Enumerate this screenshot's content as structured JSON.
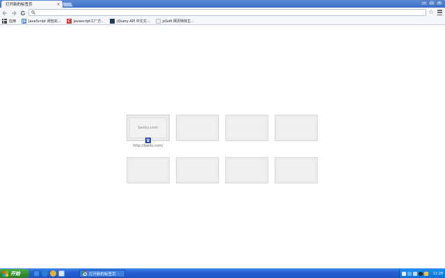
{
  "browser": {
    "tab": {
      "title": "打开新的标签页",
      "close": "×"
    },
    "window_controls": {
      "minimize": "–",
      "maximize": "□",
      "close": "×"
    },
    "omnibox": {
      "value": "",
      "placeholder": ""
    },
    "icons": {
      "back": "back-arrow-icon",
      "forward": "forward-arrow-icon",
      "reload": "reload-icon",
      "star": "star-icon",
      "menu": "menu-icon"
    }
  },
  "bookmarks": {
    "apps_label": "应用",
    "items": [
      {
        "label": "JavaScript 闭包完…",
        "icon_color": "#4a84d6",
        "icon_text": "JS"
      },
      {
        "label": "javascript工厂方…",
        "icon_color": "#d8312c",
        "icon_text": "C"
      },
      {
        "label": "jQuery API 中文文…",
        "icon_color": "#1d3b5b",
        "icon_text": ""
      },
      {
        "label": "jsSoft 网页特效主…",
        "icon_color": "#eef0f3",
        "icon_text": ""
      }
    ]
  },
  "new_tab_page": {
    "tiles": [
      {
        "title": "baidu.com",
        "url": "http://baidu.com/"
      }
    ]
  },
  "taskbar": {
    "start_label": "开始",
    "task_button": "打开新的标签页",
    "task_arrow": "-",
    "clock": "11:29",
    "accent": "#245ed0"
  }
}
